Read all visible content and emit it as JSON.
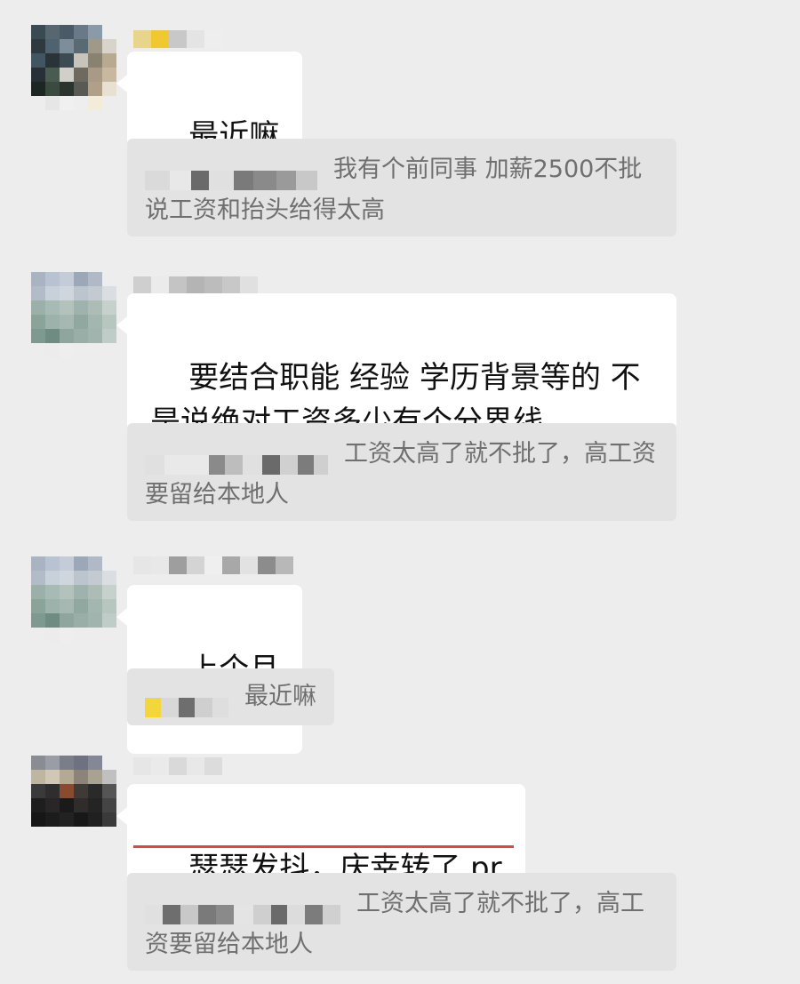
{
  "messages": [
    {
      "id": 1,
      "avatar_icon": "pixelated-avatar-icon",
      "text": "最近嘛",
      "quote": {
        "text": "我有个前同事 加薪2500不批 说工资和抬头给得太高"
      }
    },
    {
      "id": 2,
      "avatar_icon": "pixelated-avatar-icon",
      "text": "要结合职能 经验 学历背景等的 不是说绝对工资多少有个分界线",
      "quote": {
        "text": "工资太高了就不批了，高工资要留给本地人"
      }
    },
    {
      "id": 3,
      "avatar_icon": "pixelated-avatar-icon",
      "text": "上个月",
      "quote": {
        "text": "最近嘛"
      }
    },
    {
      "id": 4,
      "avatar_icon": "pixelated-avatar-icon",
      "text": "瑟瑟发抖，庆幸转了 pr",
      "highlight_color": "#e8413e",
      "quote": {
        "text": "工资太高了就不批了，高工资要留给本地人"
      }
    }
  ]
}
